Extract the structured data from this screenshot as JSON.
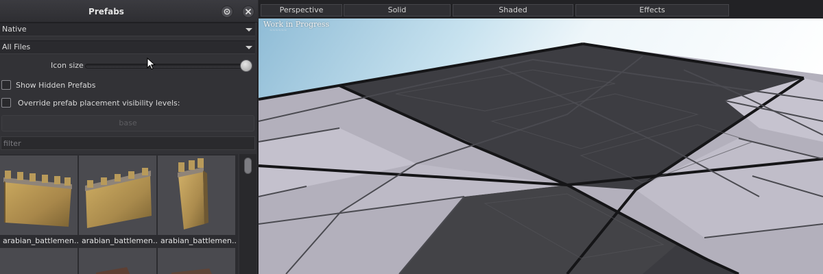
{
  "panel": {
    "title": "Prefabs",
    "settings_icon": "gear-icon",
    "close_icon": "close-icon",
    "source_dropdown": {
      "value": "Native"
    },
    "files_dropdown": {
      "value": "All Files"
    },
    "icon_size": {
      "label": "Icon size",
      "value": 1.0
    },
    "show_hidden": {
      "label": "Show Hidden Prefabs",
      "checked": false
    },
    "override_visibility": {
      "label": "Override prefab placement visibility levels:",
      "checked": false
    },
    "base_button": {
      "label": "base",
      "enabled": false
    },
    "filter": {
      "placeholder": "filter",
      "value": ""
    },
    "items": [
      {
        "label": "arabian_battlemen..."
      },
      {
        "label": "arabian_battlemen..."
      },
      {
        "label": "arabian_battlemen..."
      }
    ]
  },
  "viewport": {
    "toolbar": [
      "Perspective",
      "Solid",
      "Shaded",
      "Effects"
    ],
    "watermark": "Work in Progress"
  },
  "colors": {
    "panel_bg": "#323236",
    "toolbar_bg": "#222225",
    "grid_dark": "#3d3d41",
    "grid_light": "#b2afbb",
    "sky": "#a9cfe2"
  }
}
